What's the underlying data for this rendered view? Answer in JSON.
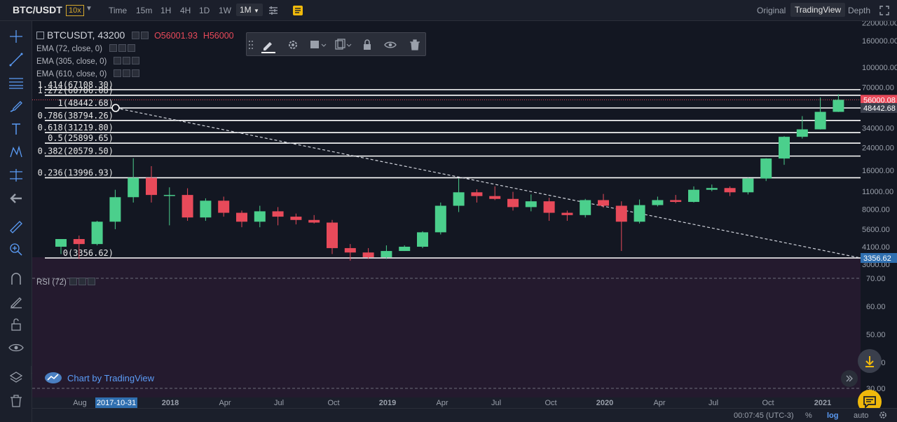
{
  "header": {
    "symbol": "BTC/USDT",
    "leverage": "10x",
    "timeframes": [
      "Time",
      "15m",
      "1H",
      "4H",
      "1D",
      "1W"
    ],
    "active_timeframe": "1M",
    "views": [
      "Original",
      "TradingView",
      "Depth"
    ],
    "active_view": "TradingView"
  },
  "legend": {
    "title": "BTCUSDT, 43200",
    "ohlc_o": "O56001.93",
    "ohlc_h": "H56000",
    "indicators": [
      "EMA (72, close, 0)",
      "EMA (305, close, 0)",
      "EMA (610, close, 0)"
    ],
    "rsi": "RSI (72)"
  },
  "footer": {
    "brand": "Chart by TradingView",
    "clock": "00:07:45 (UTC-3)",
    "percent": "%",
    "log": "log",
    "auto": "auto"
  },
  "colors": {
    "background": "#131722",
    "up": "#4bcf8c",
    "down": "#e84a5a",
    "fib_line": "#ffffff",
    "rsi_bg": "#241a2e",
    "accent": "#f0a92e"
  },
  "chart_data": {
    "type": "candlestick",
    "scale": "log",
    "ylim": [
      2800,
      220000
    ],
    "y_ticks": [
      220000,
      160000,
      100000,
      70000,
      34000,
      24000,
      16000,
      11000,
      8000,
      5600,
      4100,
      3000
    ],
    "y_tick_labels": [
      "220000.00",
      "160000.00",
      "100000.00",
      "70000.00",
      "34000.00",
      "24000.00",
      "16000.00",
      "11000.00",
      "8000.00",
      "5600.00",
      "4100.00",
      "3000.00"
    ],
    "price_badges": [
      {
        "label": "56000.08",
        "value": 56000,
        "color": "#e84a5a"
      },
      {
        "label": "48442.68",
        "value": 48442,
        "color": "#3a3f4c"
      },
      {
        "label": "3356.62",
        "value": 3356.62,
        "color": "#2f6fb0"
      }
    ],
    "x_labels": [
      "Aug",
      "2017-10-31",
      "2018",
      "Apr",
      "Jul",
      "Oct",
      "2019",
      "Apr",
      "Jul",
      "Oct",
      "2020",
      "Apr",
      "Jul",
      "Oct",
      "2021"
    ],
    "fib_levels": [
      {
        "label": "1.414(67108.30)",
        "value": 67108.3
      },
      {
        "label": "1.272(60706.08)",
        "value": 60706.08
      },
      {
        "label": "1(48442.68)",
        "value": 48442.68
      },
      {
        "label": "0.786(38794.26)",
        "value": 38794.26
      },
      {
        "label": "0.618(31219.80)",
        "value": 31219.8
      },
      {
        "label": "0.5(25899.65)",
        "value": 25899.65
      },
      {
        "label": "0.382(20579.50)",
        "value": 20579.5
      },
      {
        "label": "0.236(13996.93)",
        "value": 13996.93
      },
      {
        "label": "0(3356.62)",
        "value": 3356.62
      }
    ],
    "trendline": {
      "from": 48442.68,
      "to": 3356.62
    },
    "candles": [
      {
        "o": 4100,
        "h": 4700,
        "l": 3600,
        "c": 4700
      },
      {
        "o": 4700,
        "h": 5000,
        "l": 3300,
        "c": 4300
      },
      {
        "o": 4300,
        "h": 6500,
        "l": 4200,
        "c": 6400
      },
      {
        "o": 6400,
        "h": 11300,
        "l": 5600,
        "c": 9900
      },
      {
        "o": 9900,
        "h": 19800,
        "l": 9000,
        "c": 14000
      },
      {
        "o": 14000,
        "h": 17200,
        "l": 9000,
        "c": 10300
      },
      {
        "o": 10300,
        "h": 11800,
        "l": 6000,
        "c": 10300
      },
      {
        "o": 10300,
        "h": 11600,
        "l": 6500,
        "c": 6900
      },
      {
        "o": 6900,
        "h": 9700,
        "l": 6500,
        "c": 9300
      },
      {
        "o": 9300,
        "h": 10000,
        "l": 7000,
        "c": 7500
      },
      {
        "o": 7500,
        "h": 7800,
        "l": 5800,
        "c": 6400
      },
      {
        "o": 6400,
        "h": 8500,
        "l": 5800,
        "c": 7700
      },
      {
        "o": 7700,
        "h": 8300,
        "l": 6000,
        "c": 7000
      },
      {
        "o": 7000,
        "h": 7400,
        "l": 6100,
        "c": 6600
      },
      {
        "o": 6600,
        "h": 7200,
        "l": 6200,
        "c": 6300
      },
      {
        "o": 6300,
        "h": 6600,
        "l": 3600,
        "c": 4000
      },
      {
        "o": 4000,
        "h": 4300,
        "l": 3200,
        "c": 3700
      },
      {
        "o": 3700,
        "h": 4000,
        "l": 3300,
        "c": 3400
      },
      {
        "o": 3400,
        "h": 4200,
        "l": 3300,
        "c": 3800
      },
      {
        "o": 3800,
        "h": 4200,
        "l": 3800,
        "c": 4100
      },
      {
        "o": 4100,
        "h": 5400,
        "l": 4000,
        "c": 5300
      },
      {
        "o": 5300,
        "h": 9000,
        "l": 5100,
        "c": 8500
      },
      {
        "o": 8500,
        "h": 13800,
        "l": 7600,
        "c": 10800
      },
      {
        "o": 10800,
        "h": 11400,
        "l": 9000,
        "c": 10100
      },
      {
        "o": 10100,
        "h": 12000,
        "l": 9400,
        "c": 9600
      },
      {
        "o": 9600,
        "h": 10900,
        "l": 7800,
        "c": 8300
      },
      {
        "o": 8300,
        "h": 10400,
        "l": 7700,
        "c": 9200
      },
      {
        "o": 9200,
        "h": 9800,
        "l": 6500,
        "c": 7500
      },
      {
        "o": 7500,
        "h": 7800,
        "l": 6500,
        "c": 7200
      },
      {
        "o": 7200,
        "h": 9600,
        "l": 6900,
        "c": 9400
      },
      {
        "o": 9400,
        "h": 10500,
        "l": 8200,
        "c": 8500
      },
      {
        "o": 8500,
        "h": 9200,
        "l": 3800,
        "c": 6400
      },
      {
        "o": 6400,
        "h": 9500,
        "l": 6200,
        "c": 8600
      },
      {
        "o": 8600,
        "h": 10000,
        "l": 8400,
        "c": 9400
      },
      {
        "o": 9400,
        "h": 10300,
        "l": 8900,
        "c": 9100
      },
      {
        "o": 9100,
        "h": 12000,
        "l": 9000,
        "c": 11300
      },
      {
        "o": 11300,
        "h": 12400,
        "l": 11000,
        "c": 11650
      },
      {
        "o": 11650,
        "h": 12000,
        "l": 10100,
        "c": 10800
      },
      {
        "o": 10800,
        "h": 14000,
        "l": 10400,
        "c": 13800
      },
      {
        "o": 13800,
        "h": 19800,
        "l": 13200,
        "c": 19700
      },
      {
        "o": 19700,
        "h": 29300,
        "l": 17600,
        "c": 29000
      },
      {
        "o": 29000,
        "h": 41900,
        "l": 28100,
        "c": 33100
      },
      {
        "o": 33100,
        "h": 58300,
        "l": 33000,
        "c": 45200
      },
      {
        "o": 45200,
        "h": 61800,
        "l": 45100,
        "c": 56000
      }
    ]
  }
}
